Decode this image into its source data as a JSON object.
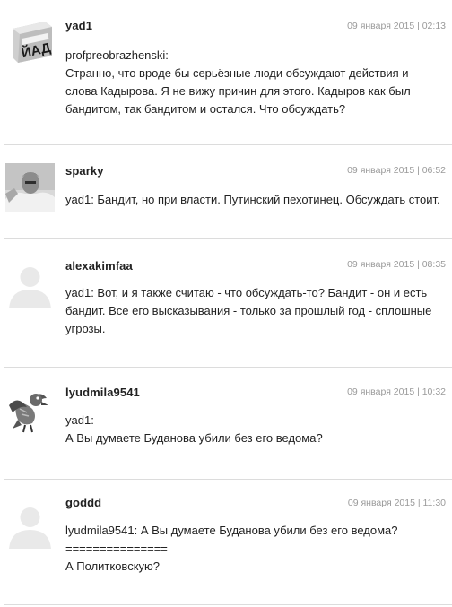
{
  "comments": [
    {
      "author": "yad1",
      "time": "09 января 2015 | 02:13",
      "avatar_icon": "yad-package-icon",
      "lines": [
        "profpreobrazhenski:",
        "Странно, что вроде бы серьёзные люди обсуждают действия и",
        "слова Кадырова. Я не вижу причин для этого. Кадыров как был",
        "бандитом, так бандитом и остался. Что обсуждать?"
      ]
    },
    {
      "author": "sparky",
      "time": "09 января 2015 | 06:52",
      "avatar_icon": "user-photo-icon",
      "lines": [
        "yad1: Бандит, но при власти. Путинский пехотинец. Обсуждать стоит."
      ]
    },
    {
      "author": "alexakimfaa",
      "time": "09 января 2015 | 08:35",
      "avatar_icon": "default-avatar-icon",
      "lines": [
        "yad1: Вот, и я также считаю - что обсуждать-то? Бандит - он и есть",
        "бандит. Все его высказывания - только за прошлый год - сплошные",
        "угрозы."
      ]
    },
    {
      "author": "lyudmila9541",
      "time": "09 января 2015 | 10:32",
      "avatar_icon": "bird-icon",
      "lines": [
        "yad1:",
        "А Вы думаете Буданова убили без его ведома?"
      ]
    },
    {
      "author": "goddd",
      "time": "09 января 2015 | 11:30",
      "avatar_icon": "default-avatar-icon",
      "lines": [
        "lyudmila9541: А Вы думаете Буданова убили без его ведома?",
        "===============",
        "А Политковскую?"
      ]
    }
  ],
  "colors": {
    "text": "#222222",
    "timestamp": "#9a9a9a",
    "separator": "#dcdcdc",
    "default_avatar": "#e9e9e9"
  }
}
